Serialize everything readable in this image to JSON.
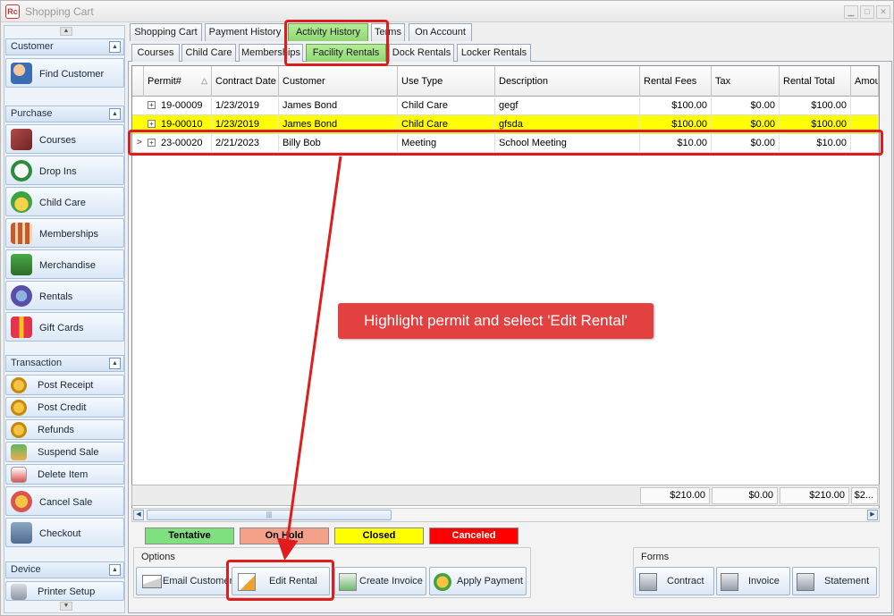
{
  "window": {
    "title": "Shopping Cart",
    "icon_label": "Rc"
  },
  "sidebar": {
    "groups": [
      {
        "title": "Customer",
        "items": [
          {
            "label": "Find Customer",
            "icon": "find-customer-icon"
          }
        ]
      },
      {
        "title": "Purchase",
        "items": [
          {
            "label": "Courses",
            "icon": "courses-icon"
          },
          {
            "label": "Drop Ins",
            "icon": "drop-ins-icon"
          },
          {
            "label": "Child Care",
            "icon": "child-care-icon"
          },
          {
            "label": "Memberships",
            "icon": "memberships-icon"
          },
          {
            "label": "Merchandise",
            "icon": "merchandise-icon"
          },
          {
            "label": "Rentals",
            "icon": "rentals-icon"
          },
          {
            "label": "Gift Cards",
            "icon": "gift-cards-icon"
          }
        ]
      },
      {
        "title": "Transaction",
        "items": [
          {
            "label": "Post Receipt",
            "icon": "post-receipt-icon"
          },
          {
            "label": "Post Credit",
            "icon": "post-credit-icon"
          },
          {
            "label": "Refunds",
            "icon": "refunds-icon"
          },
          {
            "label": "Suspend Sale",
            "icon": "suspend-sale-icon"
          },
          {
            "label": "Delete Item",
            "icon": "delete-item-icon"
          },
          {
            "label": "Cancel Sale",
            "icon": "cancel-sale-icon"
          },
          {
            "label": "Checkout",
            "icon": "checkout-icon"
          }
        ]
      },
      {
        "title": "Device",
        "items": [
          {
            "label": "Printer Setup",
            "icon": "printer-setup-icon"
          }
        ]
      }
    ]
  },
  "tabs": {
    "main": [
      "Shopping Cart",
      "Payment History",
      "Activity History",
      "Terms",
      "On Account"
    ],
    "main_active": "Activity History",
    "sub": [
      "Courses",
      "Child Care",
      "Memberships",
      "Facility Rentals",
      "Dock Rentals",
      "Locker Rentals"
    ],
    "sub_active": "Facility Rentals"
  },
  "grid": {
    "columns": [
      "Permit#",
      "Contract Date",
      "Customer",
      "Use Type",
      "Description",
      "Rental Fees",
      "Tax",
      "Rental Total",
      "Amour"
    ],
    "sort_indicator": "△",
    "rows": [
      {
        "permit": "19-00009",
        "date": "1/23/2019",
        "customer": "James Bond",
        "use_type": "Child Care",
        "description": "gegf",
        "fees": "$100.00",
        "tax": "$0.00",
        "total": "$100.00",
        "status_color": "#ffffff"
      },
      {
        "permit": "19-00010",
        "date": "1/23/2019",
        "customer": "James Bond",
        "use_type": "Child Care",
        "description": "gfsda",
        "fees": "$100.00",
        "tax": "$0.00",
        "total": "$100.00",
        "status_color": "#ffff00"
      },
      {
        "permit": "23-00020",
        "date": "2/21/2023",
        "customer": "Billy Bob",
        "use_type": "Meeting",
        "description": "School Meeting",
        "fees": "$10.00",
        "tax": "$0.00",
        "total": "$10.00",
        "status_color": "#ffffff"
      }
    ],
    "summary": {
      "fees": "$210.00",
      "tax": "$0.00",
      "total": "$210.00",
      "amount": "$2..."
    }
  },
  "legend": [
    {
      "label": "Tentative",
      "color": "#7fe07f"
    },
    {
      "label": "On Hold",
      "color": "#f5a088"
    },
    {
      "label": "Closed",
      "color": "#ffff00"
    },
    {
      "label": "Canceled",
      "color": "#ff0000"
    }
  ],
  "options": {
    "title": "Options",
    "buttons": [
      "Email Customer",
      "Edit Rental",
      "Create Invoice",
      "Apply Payment"
    ]
  },
  "forms": {
    "title": "Forms",
    "buttons": [
      "Contract",
      "Invoice",
      "Statement"
    ]
  },
  "annotation": {
    "callout": "Highlight permit and select 'Edit Rental'",
    "color": "#e01d1d"
  }
}
